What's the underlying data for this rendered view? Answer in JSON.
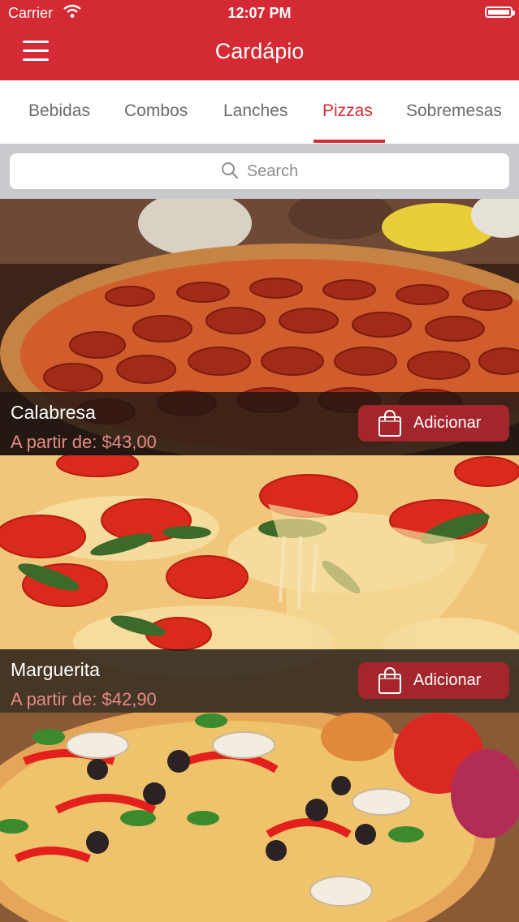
{
  "status_bar": {
    "carrier": "Carrier",
    "time": "12:07 PM"
  },
  "header": {
    "title": "Cardápio"
  },
  "tabs": [
    {
      "label": "Bebidas"
    },
    {
      "label": "Combos"
    },
    {
      "label": "Lanches"
    },
    {
      "label": "Pizzas",
      "active": true
    },
    {
      "label": "Sobremesas"
    }
  ],
  "search": {
    "placeholder": "Search"
  },
  "products": [
    {
      "name": "Calabresa",
      "price": "A partir de: $43,00",
      "button": "Adicionar"
    },
    {
      "name": "Marguerita",
      "price": "A partir de: $42,90",
      "button": "Adicionar"
    }
  ],
  "colors": {
    "brand": "#d32a33",
    "button": "#a4262c",
    "price": "#e58b84"
  }
}
